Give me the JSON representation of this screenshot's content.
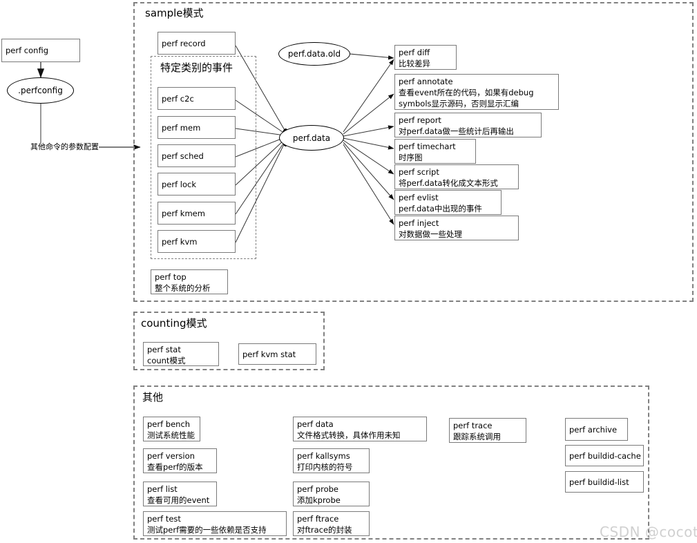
{
  "diagram": {
    "title_watermark": "CSDN @cocoti"
  },
  "config_chain": {
    "config_box": "perf config",
    "config_file": ".perfconfig",
    "edge_label": "其他命令的参数配置"
  },
  "sample_group": {
    "title": "sample模式",
    "record": "perf record",
    "events_group_title": "特定类别的事件",
    "events": [
      {
        "name": "perf c2c"
      },
      {
        "name": "perf mem"
      },
      {
        "name": "perf sched"
      },
      {
        "name": "perf lock"
      },
      {
        "name": "perf kmem"
      },
      {
        "name": "perf kvm"
      }
    ],
    "top": {
      "l1": "perf top",
      "l2": "整个系统的分析"
    },
    "data_old": "perf.data.old",
    "data": "perf.data",
    "outputs": [
      {
        "l1": "perf diff",
        "l2": "比较差异",
        "l3": ""
      },
      {
        "l1": "perf annotate",
        "l2": "查看event所在的代码，如果有debug",
        "l3": "symbols显示源码，否则显示汇编"
      },
      {
        "l1": "perf report",
        "l2": "对perf.data做一些统计后再输出",
        "l3": ""
      },
      {
        "l1": "perf timechart",
        "l2": "时序图",
        "l3": ""
      },
      {
        "l1": "perf script",
        "l2": "将perf.data转化成文本形式",
        "l3": ""
      },
      {
        "l1": "perf evlist",
        "l2": "perf.data中出现的事件",
        "l3": ""
      },
      {
        "l1": "perf inject",
        "l2": "对数据做一些处理",
        "l3": ""
      }
    ]
  },
  "counting_group": {
    "title": "counting模式",
    "items": [
      {
        "l1": "perf stat",
        "l2": "count模式"
      },
      {
        "l1": "perf kvm stat",
        "l2": ""
      }
    ]
  },
  "other_group": {
    "title": "其他",
    "col1": [
      {
        "l1": "perf bench",
        "l2": "测试系统性能"
      },
      {
        "l1": "perf version",
        "l2": "查看perf的版本"
      },
      {
        "l1": "perf list",
        "l2": "查看可用的event"
      },
      {
        "l1": "perf test",
        "l2": "测试perf需要的一些依赖是否支持"
      }
    ],
    "col2": [
      {
        "l1": "perf data",
        "l2": "文件格式转换，具体作用未知"
      },
      {
        "l1": "perf kallsyms",
        "l2": "打印内核的符号"
      },
      {
        "l1": "perf probe",
        "l2": "添加kprobe"
      },
      {
        "l1": "perf ftrace",
        "l2": "对ftrace的封装"
      }
    ],
    "col3": [
      {
        "l1": "perf trace",
        "l2": "跟踪系统调用"
      }
    ],
    "col4": [
      {
        "l1": "perf archive",
        "l2": ""
      },
      {
        "l1": "perf buildid-cache",
        "l2": ""
      },
      {
        "l1": "perf buildid-list",
        "l2": ""
      }
    ]
  },
  "colors": {
    "border": "#7a7a7a",
    "dashed": "#808080",
    "line": "#3a3a3a",
    "watermark": "#d0d0d0"
  }
}
